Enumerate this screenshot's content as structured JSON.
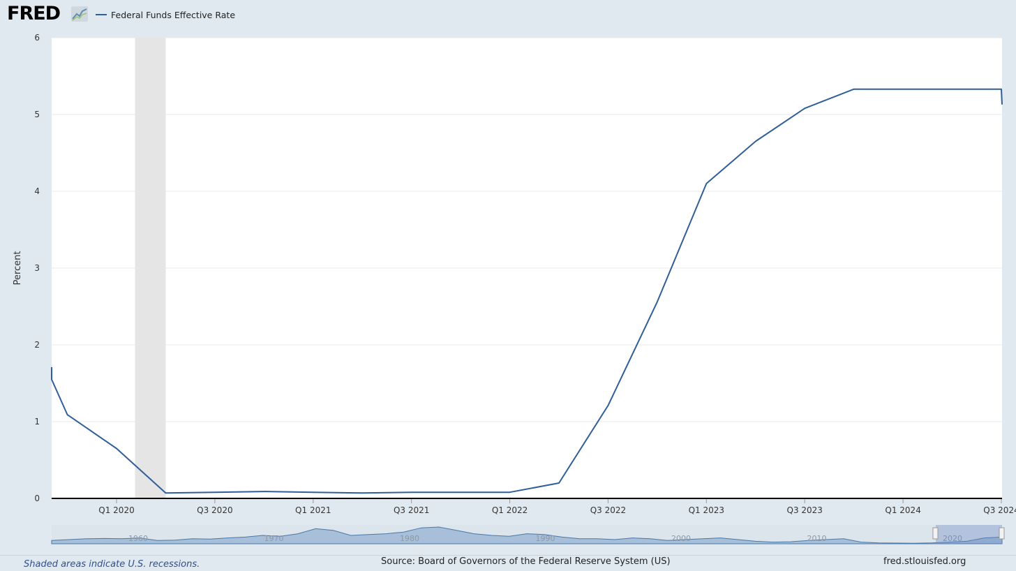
{
  "header": {
    "logo_text": "FRED",
    "logo_icon": "chart-line-icon",
    "legend_label": "Federal Funds Effective Rate",
    "series_color": "#2f5e98"
  },
  "footer": {
    "note": "Shaded areas indicate U.S. recessions.",
    "source": "Source: Board of Governors of the Federal Reserve System (US)",
    "site": "fred.stlouisfed.org"
  },
  "navigator": {
    "year_labels": [
      "1960",
      "1970",
      "1980",
      "1990",
      "2000",
      "2010",
      "2020"
    ]
  },
  "chart_data": {
    "type": "line",
    "title": "",
    "xlabel": "",
    "ylabel": "Percent",
    "ylim": [
      0,
      6
    ],
    "yticks": [
      0,
      1,
      2,
      3,
      4,
      5,
      6
    ],
    "xticks": [
      "Q1 2020",
      "Q3 2020",
      "Q1 2021",
      "Q3 2021",
      "Q1 2022",
      "Q3 2022",
      "Q1 2023",
      "Q3 2023",
      "Q1 2024",
      "Q3 2024"
    ],
    "grid": true,
    "legend": "top-left",
    "recession": {
      "start": "2020-02",
      "end": "2020-04"
    },
    "series": [
      {
        "name": "Federal Funds Effective Rate",
        "color": "#2f5e98",
        "x": [
          "2019-07",
          "2019-08",
          "2019-10",
          "2020-01",
          "2020-04",
          "2020-07",
          "2020-10",
          "2021-01",
          "2021-04",
          "2021-07",
          "2021-10",
          "2022-01",
          "2022-04",
          "2022-07",
          "2022-10",
          "2023-01",
          "2023-04",
          "2023-07",
          "2023-10",
          "2024-01",
          "2024-04",
          "2024-07",
          "2024-10"
        ],
        "values": [
          1.71,
          1.55,
          1.09,
          0.65,
          0.07,
          0.08,
          0.09,
          0.08,
          0.07,
          0.08,
          0.08,
          0.08,
          0.2,
          1.21,
          2.56,
          4.1,
          4.65,
          5.08,
          5.33,
          5.33,
          5.33,
          5.33,
          5.13
        ]
      }
    ]
  }
}
